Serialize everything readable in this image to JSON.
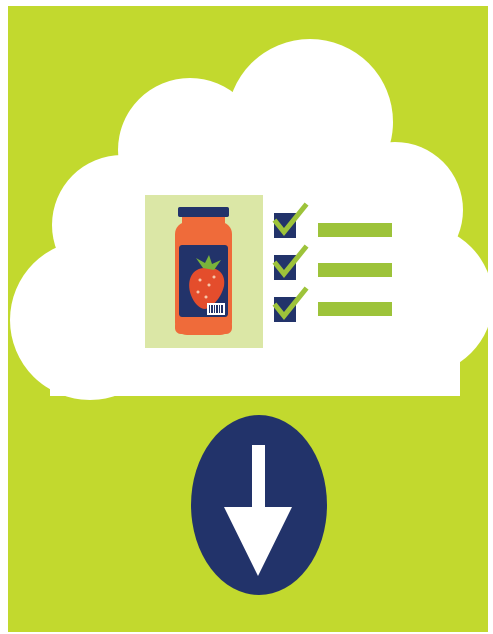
{
  "illustration": {
    "cloud_icon": "cloud-icon",
    "jar_icon": "jam-jar-icon",
    "strawberry_icon": "strawberry-icon",
    "barcode_icon": "barcode-icon",
    "checklist_icon": "checklist-icon",
    "download_icon": "download-arrow-icon",
    "checklist_items": 3
  },
  "colors": {
    "background": "#c2d92e",
    "cloud": "#ffffff",
    "jar_panel": "#dbe7a6",
    "jar_body": "#ef6b3a",
    "jar_label": "#22336a",
    "strawberry": "#e44d2c",
    "leaf": "#79b33b",
    "checkbox": "#22336a",
    "checkmark": "#9dc33a",
    "line": "#9dc33a",
    "download_circle": "#22336a",
    "download_arrow": "#ffffff"
  }
}
